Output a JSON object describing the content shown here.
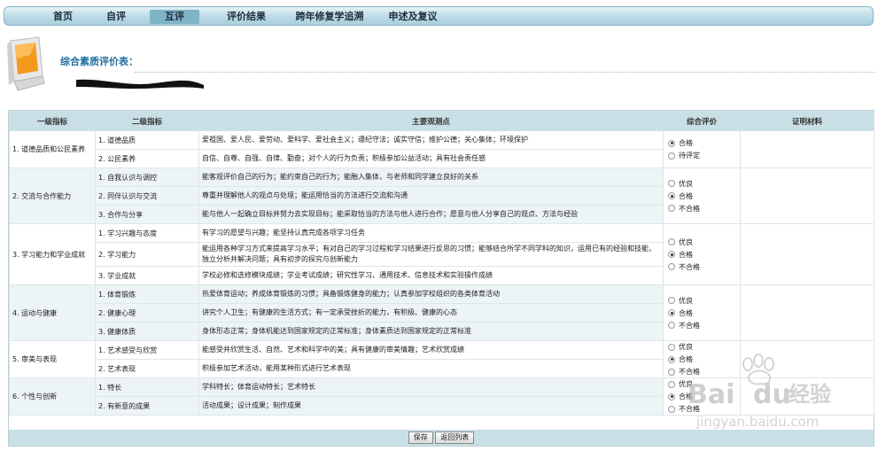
{
  "nav": {
    "items": [
      {
        "label": "首页"
      },
      {
        "label": "自评"
      },
      {
        "label": "互评"
      },
      {
        "label": "评价结果"
      },
      {
        "label": "跨年修复学追溯"
      },
      {
        "label": "申述及复议"
      }
    ],
    "active": "互评"
  },
  "page_title": "综合素质评价表：",
  "table": {
    "headers": [
      "一级指标",
      "二级指标",
      "主要观测点",
      "综合评价",
      "证明材料"
    ],
    "groups": [
      {
        "level1": "1. 道德品质和公民素养",
        "rows": [
          {
            "level2": "1. 道德品质",
            "obs": "爱祖国、爱人民、爱劳动、爱科学、爱社会主义；遵纪守法；诚实守信；维护公德；关心集体；环境保护"
          },
          {
            "level2": "2. 公民素养",
            "obs": "自信、自尊、自强、自律、勤奋；对个人的行为负责；积极参加公益活动；具有社会责任感"
          }
        ],
        "options": [
          "合格",
          "待评定"
        ],
        "selected": "合格"
      },
      {
        "level1": "2. 交流与合作能力",
        "rows": [
          {
            "level2": "1. 自我认识与调控",
            "obs": "能客观评价自己的行为；能约束自己的行为；能融入集体，与老师和同学建立良好的关系"
          },
          {
            "level2": "2. 同伴认识与交流",
            "obs": "尊重并理解他人的观点与处境；能运用恰当的方法进行交流和沟通"
          },
          {
            "level2": "3. 合作与分享",
            "obs": "能与他人一起确立目标并努力去实现目标；能采取恰当的方法与他人进行合作；愿意与他人分享自己的观点、方法与经验"
          }
        ],
        "options": [
          "优良",
          "合格",
          "不合格"
        ],
        "selected": "合格"
      },
      {
        "level1": "3. 学习能力和学业成就",
        "rows": [
          {
            "level2": "1. 学习兴趣与态度",
            "obs": "有学习的愿望与兴趣；能坚持认真完成各项学习任务"
          },
          {
            "level2": "2. 学习能力",
            "obs": "能运用各种学习方式来提高学习水平；有对自己的学习过程和学习结果进行反思的习惯；能够结合所学不同学科的知识，运用已有的经验和技能，独立分析并解决问题；具有初步的探究与创新能力"
          },
          {
            "level2": "3. 学业成就",
            "obs": "学校必修和选修模块成绩；学业考试成绩；研究性学习、通用技术、信息技术和实验操作成绩"
          }
        ],
        "options": [
          "优良",
          "合格",
          "不合格"
        ],
        "selected": "合格"
      },
      {
        "level1": "4. 运动与健康",
        "rows": [
          {
            "level2": "1. 体育锻炼",
            "obs": "热爱体育运动；养成体育锻炼的习惯；具备锻炼健身的能力；认真参加学校组织的各类体育活动"
          },
          {
            "level2": "2. 健康心理",
            "obs": "讲究个人卫生；有健康的生活方式；有一定承受挫折的能力，有积极、健康的心态"
          },
          {
            "level2": "3. 健康体质",
            "obs": "身体形态正常；身体机能达到国家规定的正常标准；身体素质达到国家规定的正常标准"
          }
        ],
        "options": [
          "优良",
          "合格",
          "不合格"
        ],
        "selected": "合格"
      },
      {
        "level1": "5. 审美与表现",
        "rows": [
          {
            "level2": "1. 艺术感受与欣赏",
            "obs": "能感受并欣赏生活、自然、艺术和科学中的美；具有健康的审美情趣；艺术欣赏成绩"
          },
          {
            "level2": "2. 艺术表现",
            "obs": "积极参加艺术活动，能用某种形式进行艺术表现"
          }
        ],
        "options": [
          "优良",
          "合格",
          "不合格"
        ],
        "selected": "合格"
      },
      {
        "level1": "6. 个性与创新",
        "rows": [
          {
            "level2": "1. 特长",
            "obs": "学科特长；体育运动特长；艺术特长"
          },
          {
            "level2": "2. 有新意的成果",
            "obs": "活动成果；设计成果；制作成果"
          }
        ],
        "options": [
          "优良",
          "合格",
          "不合格"
        ],
        "selected": "合格"
      }
    ]
  },
  "buttons": {
    "save": "保存",
    "back": "返回列表"
  },
  "watermark": {
    "brand": "Bai",
    "brand2": "经验",
    "url": "jingyan.baidu.com"
  },
  "colors": {
    "nav_bg": "#bcdbe6",
    "header_bg": "#c9dfe6",
    "title_blue": "#1f6ea1",
    "alt_row": "#edf4f6"
  }
}
